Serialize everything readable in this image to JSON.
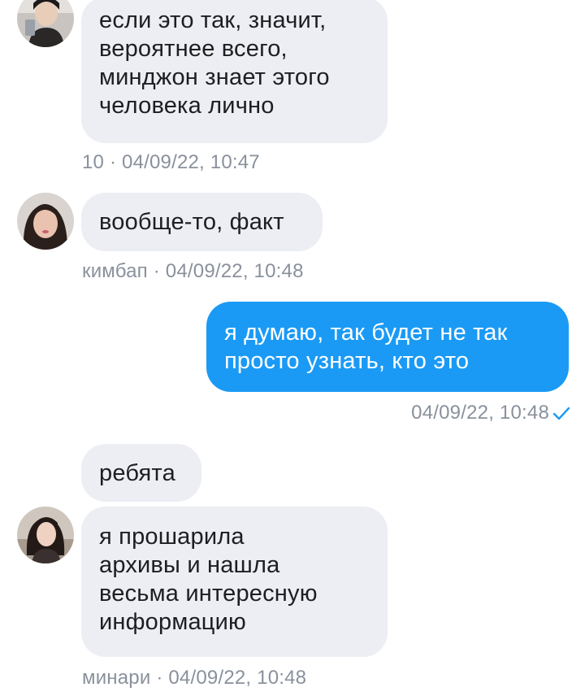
{
  "colors": {
    "incoming_bubble": "#eceef4",
    "outgoing_bubble": "#1a9af5",
    "meta_text": "#8a919c",
    "read_check": "#1a9af5"
  },
  "messages": [
    {
      "sender": "10",
      "direction": "incoming",
      "avatar_icon": "user-avatar-1",
      "lines": [
        "если это так, значит,",
        "вероятнее всего,",
        "минджон знает этого",
        "человека лично"
      ],
      "meta": "10 · 04/09/22, 10:47"
    },
    {
      "sender": "кимбап",
      "direction": "incoming",
      "avatar_icon": "user-avatar-kimbap",
      "lines": [
        "вообще-то, факт"
      ],
      "meta": "кимбап · 04/09/22, 10:48"
    },
    {
      "direction": "outgoing",
      "lines": [
        "я думаю, так будет не так",
        "просто узнать, кто это"
      ],
      "meta": "04/09/22, 10:48",
      "status_icon": "read-check-icon"
    },
    {
      "sender": "минари",
      "direction": "incoming",
      "lines": [
        "ребята"
      ]
    },
    {
      "sender": "минари",
      "direction": "incoming",
      "avatar_icon": "user-avatar-minari",
      "lines": [
        "я прошарила",
        "архивы и нашла",
        "весьма интересную",
        "информацию"
      ],
      "meta": "минари · 04/09/22, 10:48"
    }
  ]
}
